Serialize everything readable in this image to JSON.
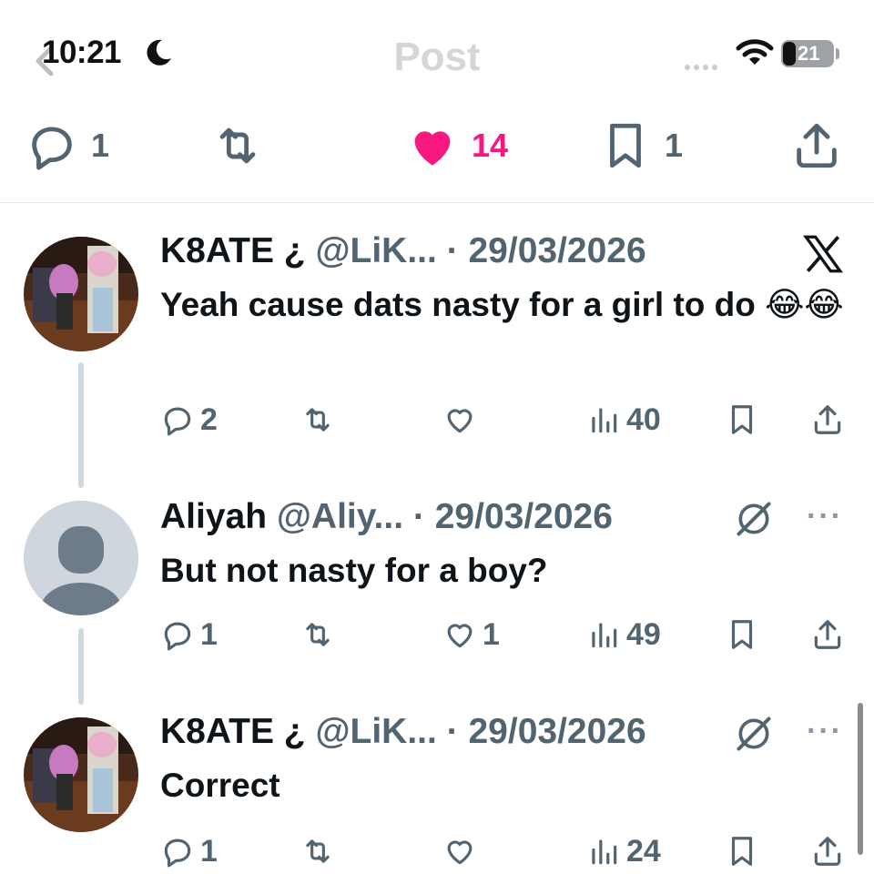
{
  "status_bar": {
    "time": "10:21",
    "battery": "21"
  },
  "header": {
    "title": "Post"
  },
  "main_actions": {
    "replies": "1",
    "likes": "14",
    "bookmarks": "1"
  },
  "posts": [
    {
      "name": "K8ATE ¿",
      "handle": "@LiK...",
      "date": "· 29/03/2026",
      "text": "Yeah cause dats nasty for a girl to do 😂😂",
      "replies": "2",
      "likes": "",
      "views": "40"
    },
    {
      "name": "Aliyah",
      "handle": "@Aliy...",
      "date": "· 29/03/2026",
      "text": "But not nasty for a boy?",
      "replies": "1",
      "likes": "1",
      "views": "49"
    },
    {
      "name": "K8ATE ¿",
      "handle": "@LiK...",
      "date": "· 29/03/2026",
      "text": "Correct",
      "replies": "1",
      "likes": "",
      "views": "24"
    }
  ],
  "colors": {
    "accent_like": "#f91880",
    "muted": "#536471",
    "thread_line": "#cfd9de"
  }
}
